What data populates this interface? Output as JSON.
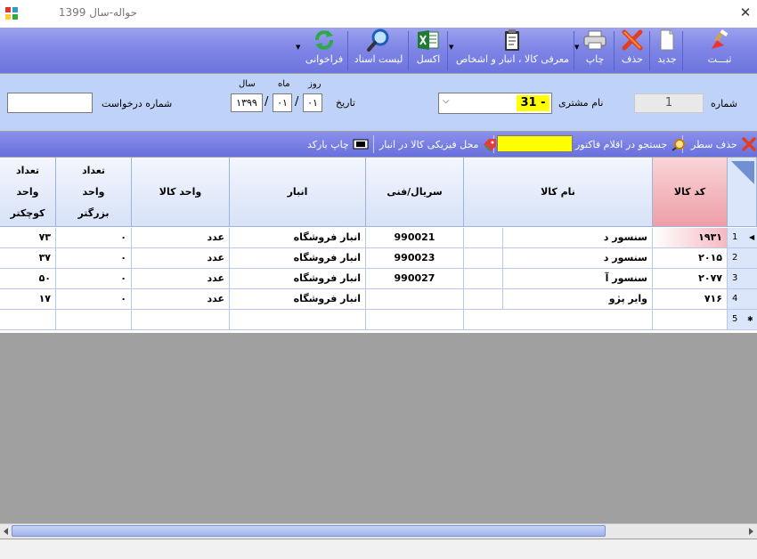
{
  "window": {
    "title": "حواله-سال 1399",
    "close_glyph": "✕"
  },
  "toolbar": {
    "buttons": [
      {
        "label": "ثبـــت",
        "icon": "brush-icon"
      },
      {
        "label": "جدید",
        "icon": "new-document-icon"
      },
      {
        "label": "حذف",
        "icon": "delete-x-icon"
      },
      {
        "label": "چاپ",
        "icon": "printer-icon"
      },
      {
        "label": "معرفی کالا ، انبار و اشخاص",
        "icon": "clipboard-icon"
      },
      {
        "label": "اکسل",
        "icon": "excel-icon"
      },
      {
        "label": "لیست اسناد",
        "icon": "search-icon"
      },
      {
        "label": "فراخوانی",
        "icon": "refresh-icon"
      }
    ]
  },
  "form": {
    "number_label": "شماره",
    "number_value": "1",
    "customer_label": "نام مشتری",
    "customer_value": "31 -",
    "date_label": "تاریخ",
    "day_label": "روز",
    "month_label": "ماه",
    "year_label": "سال",
    "day_value": "۰۱",
    "month_value": "۰۱",
    "year_value": "۱۳۹۹",
    "request_label": "شماره درخواست",
    "request_value": ""
  },
  "subtoolbar": {
    "delete_row_label": "حذف سطر",
    "search_label": "جستجو در اقلام فاکتور",
    "location_label": "محل فیزیکی کالا در انبار",
    "barcode_label": "چاپ بارکد"
  },
  "grid": {
    "columns": {
      "code": "کد کالا",
      "name": "نام کالا",
      "serial": "سریال/فنی",
      "warehouse": "انبار",
      "unit": "واحد کالا",
      "big_unit": "تعداد\nواحد\nبزرگتر",
      "small_unit": "تعداد\nواحد\nکوچکتر"
    },
    "rows": [
      {
        "num": "1",
        "code": "۱۹۳۱",
        "name": "سنسور د",
        "serial": "990021",
        "warehouse": "انبار فروشگاه",
        "unit": "عدد",
        "big": "۰",
        "small": "۷۳"
      },
      {
        "num": "2",
        "code": "۲۰۱۵",
        "name": "سنسور د",
        "serial": "990023",
        "warehouse": "انبار فروشگاه",
        "unit": "عدد",
        "big": "۰",
        "small": "۳۷"
      },
      {
        "num": "3",
        "code": "۲۰۷۷",
        "name": "سنسور آ",
        "serial": "990027",
        "warehouse": "انبار فروشگاه",
        "unit": "عدد",
        "big": "۰",
        "small": "۵۰"
      },
      {
        "num": "4",
        "code": "۷۱۶",
        "name": "وایر پژو",
        "serial": "",
        "warehouse": "انبار فروشگاه",
        "unit": "عدد",
        "big": "۰",
        "small": "۱۷"
      }
    ],
    "new_row_num": "5"
  },
  "colors": {
    "toolbar": "#7f86e6",
    "header_bg": "#bfd2f7",
    "code_header": "#f0a9b0",
    "search_box": "#ffff00",
    "customer_highlight": "#ffff00"
  }
}
